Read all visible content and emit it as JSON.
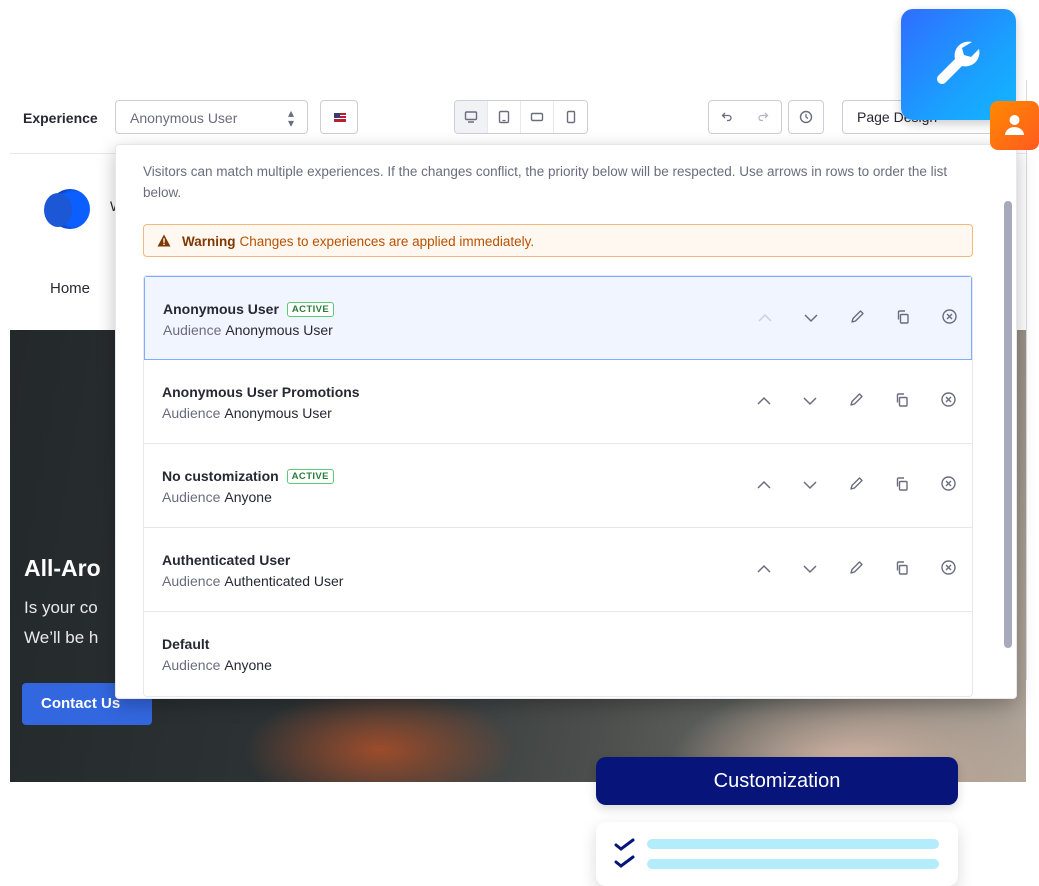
{
  "toolbar": {
    "experience_label": "Experience",
    "experience_selected": "Anonymous User",
    "devices": [
      "desktop-icon",
      "tablet-icon",
      "landscape-icon",
      "mobile-icon"
    ],
    "mode_label": "Page Design"
  },
  "page": {
    "nav_home": "Home",
    "logo_text": "W",
    "hero_title": "All-Aro",
    "hero_line1": "Is your co",
    "hero_line2": "We’ll be h",
    "contact_label": "Contact Us"
  },
  "panel": {
    "help_text": "Visitors can match multiple experiences. If the changes conflict, the priority below will be respected. Use arrows in rows to order the list below.",
    "warning_title": "Warning",
    "warning_text": "Changes to experiences are applied immediately.",
    "audience_label": "Audience",
    "experiences": [
      {
        "name": "Anonymous User",
        "badge": "ACTIVE",
        "audience": "Anonymous User",
        "selected": true,
        "up_disabled": true,
        "actions": true
      },
      {
        "name": "Anonymous User Promotions",
        "badge": "",
        "audience": "Anonymous User",
        "selected": false,
        "up_disabled": false,
        "actions": true
      },
      {
        "name": "No customization",
        "badge": "ACTIVE",
        "audience": "Anyone",
        "selected": false,
        "up_disabled": false,
        "actions": true
      },
      {
        "name": "Authenticated User",
        "badge": "",
        "audience": "Authenticated User",
        "selected": false,
        "up_disabled": false,
        "actions": true
      },
      {
        "name": "Default",
        "badge": "",
        "audience": "Anyone",
        "selected": false,
        "up_disabled": false,
        "actions": false
      }
    ]
  },
  "decor": {
    "customization_label": "Customization"
  },
  "colors": {
    "primary": "#0b5fff",
    "active_badge": "#287d3c",
    "warning": "#b95000",
    "customization_pill": "#07157a"
  }
}
